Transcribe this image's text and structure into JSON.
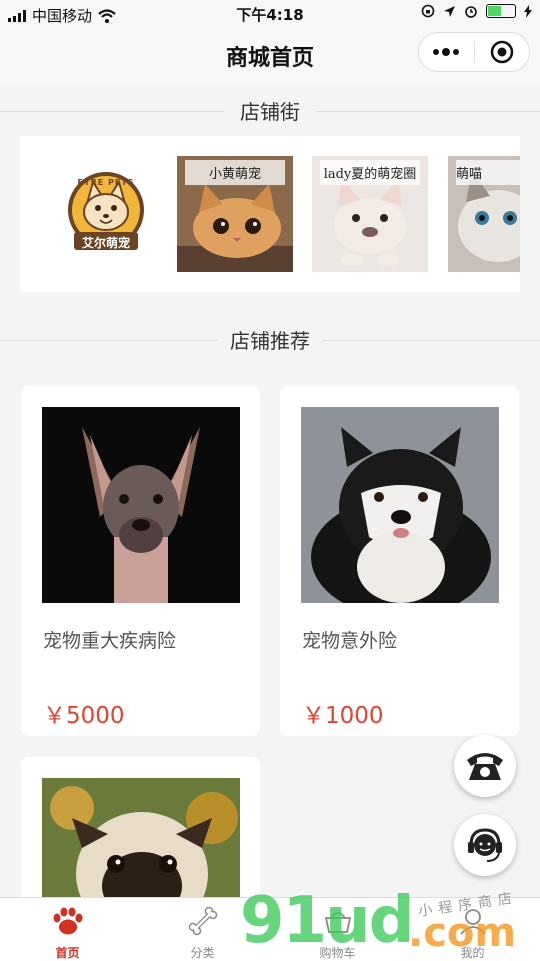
{
  "status": {
    "carrier": "中国移动",
    "time": "下午4:18",
    "battery_level": 0.55
  },
  "nav": {
    "title": "商城首页"
  },
  "shop_street": {
    "title": "店铺街",
    "shops": [
      {
        "logo_top": "EYRE PETS",
        "logo_bottom": "艾尔萌宠"
      },
      {
        "label": "小黄萌宠"
      },
      {
        "label": "lady夏的萌宠圈"
      },
      {
        "label": "萌喵"
      }
    ]
  },
  "recommend": {
    "title": "店铺推荐",
    "products": [
      {
        "name": "宠物重大疾病险",
        "price": "￥5000"
      },
      {
        "name": "宠物意外险",
        "price": "￥1000"
      },
      {
        "name": "",
        "price": ""
      }
    ]
  },
  "tabbar": {
    "items": [
      {
        "label": "首页",
        "icon": "paw-icon"
      },
      {
        "label": "分类",
        "icon": "bone-icon"
      },
      {
        "label": "购物车",
        "icon": "cart-icon"
      },
      {
        "label": "我的",
        "icon": "user-icon"
      }
    ]
  },
  "watermark": {
    "big": "91ud",
    "dot": ".com",
    "small": "小程序商店"
  },
  "colors": {
    "accent": "#e0452f",
    "active_tab": "#d0321f"
  }
}
